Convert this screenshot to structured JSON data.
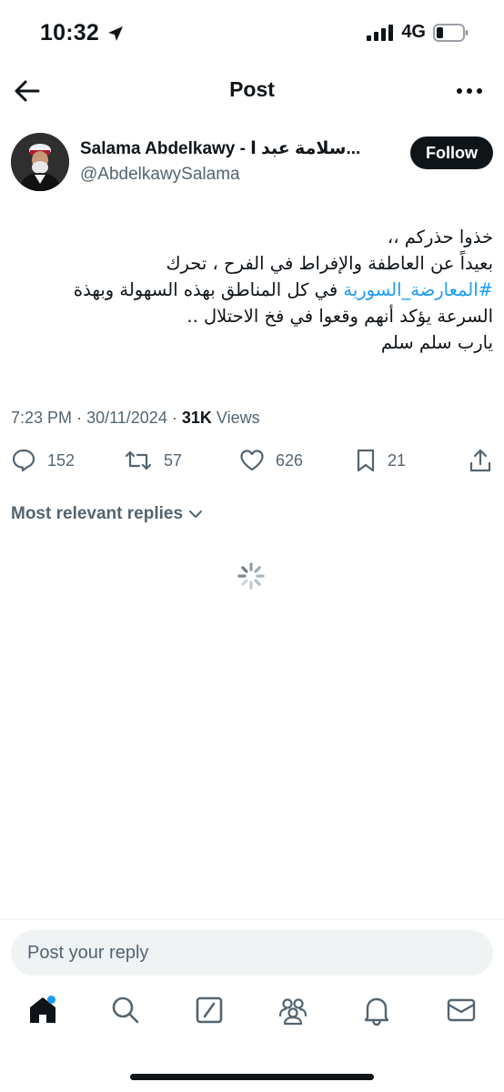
{
  "status_bar": {
    "time": "10:32",
    "network": "4G"
  },
  "header": {
    "title": "Post"
  },
  "author": {
    "display_name": "Salama Abdelkawy - سلامة عبد ا...",
    "handle": "@AbdelkawySalama",
    "follow_label": "Follow"
  },
  "tweet": {
    "line1": "خذوا حذركم ،،",
    "line2": "بعيداً عن العاطفة والإفراط في الفرح ، تحرك",
    "hashtag": "#المعارضة_السورية",
    "line3_rest": " في كل المناطق بهذه السهولة وبهذة",
    "line4": "السرعة يؤكد أنهم وقعوا في فخ الاحتلال ..",
    "line5": "يارب سلم سلم"
  },
  "meta": {
    "time": "7:23 PM",
    "separator": "·",
    "date": "30/11/2024",
    "views_count": "31K",
    "views_label": "Views"
  },
  "actions": {
    "replies": "152",
    "reposts": "57",
    "likes": "626",
    "bookmarks": "21"
  },
  "replies_sort": {
    "label": "Most relevant replies"
  },
  "reply_box": {
    "placeholder": "Post your reply"
  },
  "colors": {
    "accent": "#1d9bf0",
    "text": "#0f1419",
    "secondary": "#536471",
    "button_bg": "#0f1419"
  }
}
